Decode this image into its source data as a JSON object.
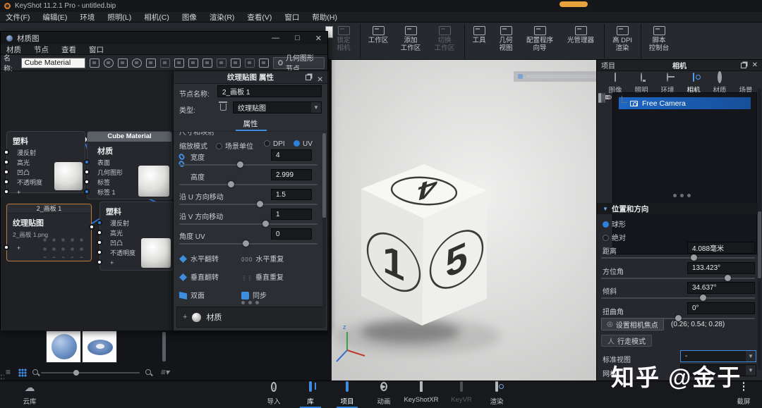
{
  "window": {
    "title": "KeyShot 11.2.1 Pro  - untitled.bip"
  },
  "menubar": [
    "文件(F)",
    "编辑(E)",
    "环境",
    "照明(L)",
    "相机(C)",
    "图像",
    "渲染(R)",
    "查看(V)",
    "窗口",
    "帮助(H)"
  ],
  "toolbar": {
    "items": [
      {
        "l1": "锁定",
        "l2": "相机"
      },
      {
        "l1": "工作区",
        "l2": ""
      },
      {
        "l1": "添加",
        "l2": "工作区"
      },
      {
        "l1": "切换",
        "l2": "工作区"
      },
      {
        "l1": "工具",
        "l2": ""
      },
      {
        "l1": "几何",
        "l2": "视图"
      },
      {
        "l1": "配置程序",
        "l2": "向导"
      },
      {
        "l1": "光管理器",
        "l2": ""
      },
      {
        "l1": "高 DPI",
        "l2": "渲染"
      },
      {
        "l1": "脚本",
        "l2": "控制台"
      }
    ]
  },
  "material_graph": {
    "title": "材质图",
    "controls": {
      "minimize": "—",
      "maximize": "□",
      "close": "✕"
    },
    "menus": [
      "材质",
      "节点",
      "查看",
      "窗口"
    ],
    "name_label": "名称:",
    "material_name": "Cube Material",
    "geometry_node_button": "几何图形节点",
    "nodes": {
      "plastic_top": {
        "title": "塑料",
        "ports": [
          "漫反射",
          "高光",
          "凹凸",
          "不透明度",
          "+"
        ]
      },
      "cube_material": {
        "header": "Cube Material",
        "title": "材质",
        "ports": [
          "表面",
          "几何图形",
          "标签",
          "标签 1"
        ]
      },
      "texture": {
        "header": "2_画板 1",
        "title": "纹理贴图",
        "subtitle": "2_画板 1.png",
        "ports": [
          "+"
        ]
      },
      "plastic_bottom": {
        "title": "塑料",
        "ports": [
          "漫反射",
          "高光",
          "凹凸",
          "不透明度",
          "+"
        ]
      }
    }
  },
  "texture_properties": {
    "title": "纹理贴图 属性",
    "close": "✕",
    "node_name_label": "节点名称:",
    "node_name": "2_画板 1",
    "type_label": "类型:",
    "type_value": "纹理贴图",
    "tab": "属性",
    "scrolled_section": "尺寸和映射",
    "scale_mode_label": "缩放模式",
    "scale_modes": [
      "场景单位",
      "DPI",
      "UV"
    ],
    "fields": [
      {
        "label": "宽度",
        "value": "4",
        "slider": 0.44
      },
      {
        "label": "高度",
        "value": "2.999",
        "slider": 0.37
      },
      {
        "label": "沿 U 方向移动",
        "value": "1.5",
        "slider": 0.58
      },
      {
        "label": "沿 V 方向移动",
        "value": "1",
        "slider": 0.62
      },
      {
        "label": "角度 UV",
        "value": "0",
        "slider": 0.48
      }
    ],
    "toggles": {
      "flip_h": "水平翻转",
      "repeat_h": "水平重复",
      "flip_v": "垂直翻转",
      "repeat_v": "垂直重复",
      "two_sided": "双面",
      "sync": "同步"
    },
    "material_section": "材质"
  },
  "project_panel": {
    "panel_label": "项目",
    "title": "相机",
    "close": "✕",
    "tabs": [
      {
        "label": "图像"
      },
      {
        "label": "照明"
      },
      {
        "label": "环境"
      },
      {
        "label": "相机",
        "active": true
      },
      {
        "label": "材质"
      },
      {
        "label": "场景"
      }
    ],
    "camera_tree": {
      "selected": "Free Camera"
    },
    "section": "位置和方向",
    "coord_modes": [
      {
        "label": "球形",
        "selected": true
      },
      {
        "label": "绝对",
        "selected": false
      }
    ],
    "params": [
      {
        "label": "距离",
        "value": "4.088毫米",
        "slider": 0.6
      },
      {
        "label": "方位角",
        "value": "133.423°",
        "slider": 0.82
      },
      {
        "label": "倾斜",
        "value": "34.637°",
        "slider": 0.66
      },
      {
        "label": "扭曲角",
        "value": "0°",
        "slider": 0.5
      }
    ],
    "focus_button": "设置相机焦点",
    "focus_value": "(0.26; 0.54; 0.28)",
    "walk_button": "行走模式",
    "standard_view_label": "标准视图",
    "standard_view_value": "-",
    "grid_label": "网格"
  },
  "viewport": {
    "cube_top": "4",
    "cube_left": "1",
    "cube_right": "5",
    "axis_label": "z"
  },
  "dock": {
    "items": [
      {
        "label": "导入"
      },
      {
        "label": "库",
        "active": true
      },
      {
        "label": "项目",
        "active": true
      },
      {
        "label": "动画"
      },
      {
        "label": "KeyShotXR"
      },
      {
        "label": "KeyVR",
        "disabled": true
      },
      {
        "label": "渲染"
      }
    ],
    "cloud_label": "云库",
    "screenshot_label": "截屏"
  },
  "watermark": "知乎 @金于",
  "colors": {
    "accent": "#2f80d9",
    "selection": "#c07a3e",
    "camera_row": "#1d66c4"
  }
}
